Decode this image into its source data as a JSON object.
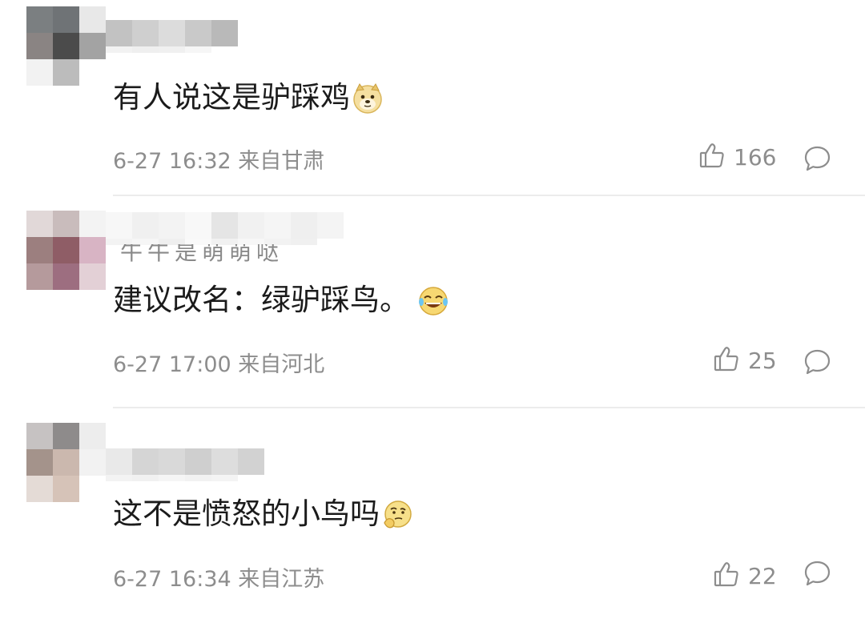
{
  "comments": [
    {
      "text": "有人说这是驴踩鸡",
      "emoji": "doge-emoji",
      "meta": "6-27 16:32 来自甘肃",
      "likes": "166",
      "avatar": [
        "#7b7f81",
        "#6f7376",
        "#e8e8e8",
        "#8a8483",
        "#4b4b4b",
        "#a3a3a3",
        "#f2f2f2",
        "#bcbcbc",
        "#ffffff"
      ],
      "name_blur": [
        "#c2c2c2",
        "#cfcfcf",
        "#dcdcdc",
        "#c9c9c9",
        "#b9b9b9"
      ],
      "name_strip": [
        "#f2f2f2",
        "#efefef",
        "#f0f0f0",
        "#f6f6f6"
      ]
    },
    {
      "text": "建议改名：绿驴踩鸟。",
      "emoji": "laugh-cry-emoji",
      "meta": "6-27 17:00 来自河北",
      "likes": "25",
      "avatar": [
        "#e1d8d8",
        "#c9bcbc",
        "#f3f3f3",
        "#9c7f7f",
        "#8f5d66",
        "#d8b4c4",
        "#b59a9c",
        "#9d6e80",
        "#e3d0d6"
      ],
      "name_blur": [
        "#f7f7f7",
        "#f0f0f0",
        "#f3f3f3",
        "#f8f8f8",
        "#e5e5e5",
        "#f1f1f1",
        "#f5f5f5",
        "#efefef",
        "#f4f4f4"
      ],
      "name_strip": [
        "#f3f3f3",
        "#f6f6f6",
        "#efefef",
        "#f9f9f9",
        "#f1f1f1",
        "#f7f7f7",
        "#f2f2f2",
        "#f0f0f0"
      ],
      "ghost_text": "牛牛是萌萌哒"
    },
    {
      "text": "这不是愤怒的小鸟吗",
      "emoji": "thinking-emoji",
      "meta": "6-27 16:34 来自江苏",
      "likes": "22",
      "avatar": [
        "#c6c2c2",
        "#8e8b8b",
        "#ededed",
        "#a4938b",
        "#cbb8ae",
        "#f2f2f2",
        "#e4dbd6",
        "#d6c3b8",
        "#ffffff"
      ],
      "name_blur": [
        "#e9e9e9",
        "#d5d5d5",
        "#d9d9d9",
        "#cfcfcf",
        "#dddddd",
        "#d2d2d2"
      ],
      "name_strip": [
        "#f3f3f3",
        "#f1f1f1",
        "#f5f5f5",
        "#f2f2f2",
        "#f4f4f4"
      ]
    }
  ],
  "icons": {
    "like": "thumbs-up-icon",
    "reply": "comment-bubble-icon"
  },
  "colors": {
    "text": "#1b1b1b",
    "meta": "#8d8d8d",
    "divider": "#ececec"
  }
}
